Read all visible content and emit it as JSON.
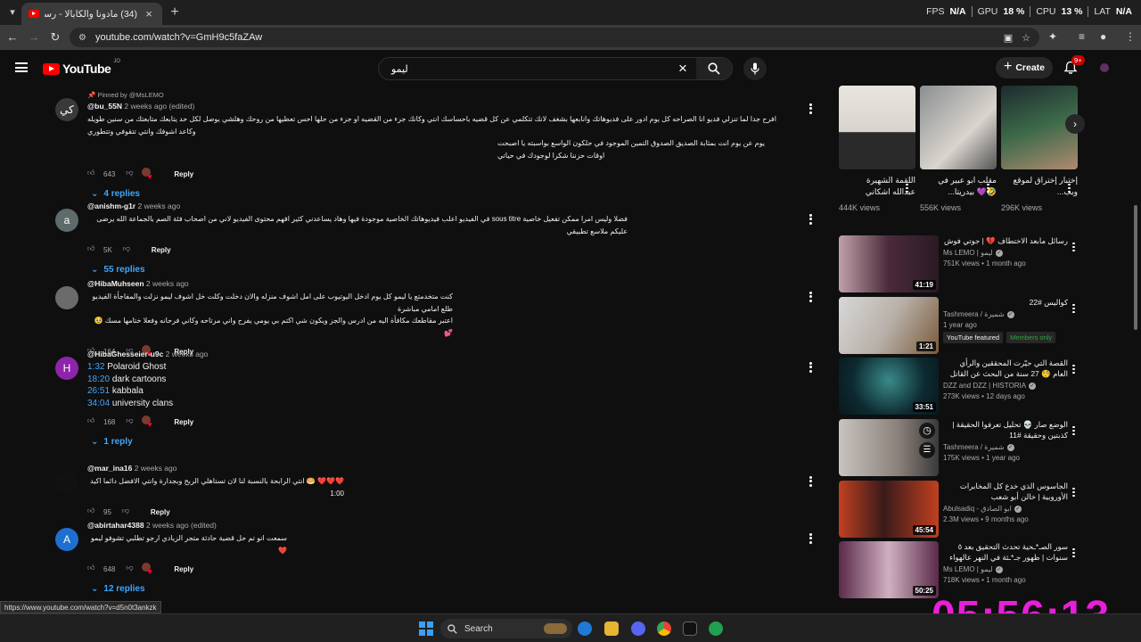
{
  "browser": {
    "tab_title": "(34) مادونا والكابالا - رسائل مبطنة...",
    "new_tab": "+",
    "url": "youtube.com/watch?v=GmH9c5faZAw",
    "stats": {
      "fps_label": "FPS",
      "fps_value": "N/A",
      "gpu_label": "GPU",
      "gpu_value": "18 %",
      "cpu_label": "CPU",
      "cpu_value": "13 %",
      "lat_label": "LAT",
      "lat_value": "N/A"
    }
  },
  "youtube": {
    "logo": "YouTube",
    "logo_country": "JO",
    "search_query": "ليمو",
    "create_label": "Create",
    "notif_badge": "9+"
  },
  "comments": [
    {
      "pinned": "Pinned by @MsLEMO",
      "author": "@bu_55N",
      "time": "2 weeks ago (edited)",
      "avatar": "كي",
      "avatar_color": "#3a3a3a",
      "lines": [
        "افرح جدا لما تنزلي فديو انا الصراحه كل يوم ادور على فديوهاتك وانابعها بشغف لانك تتكلمي عن كل قضيه باحساسك انتي وكانك جزء من القضيه او جزء من حلها احس تعطيها من روحك وهلشي يوصل لكل حد يتابعك متابعتك من سنين طويله وكاعد اشوفك وانتي تتقوفي وتتطوري",
        "يوم عن يوم انت بمثابة الصديق الصدوق التمين الموجود في حلكون الواسع بواسبته يا اصبحت اوقات حزننا شكرا لوجودك في حياتي"
      ],
      "likes": "643",
      "reply_label": "Reply",
      "replies": "4 replies"
    },
    {
      "author": "@anishm-g1r",
      "time": "2 weeks ago",
      "avatar": "a",
      "avatar_color": "#5f6a6a",
      "lines": [
        "فضلا وليس امرا ممكن تفعيل خاصية sous titre في الفيديو اعلب فيديوهاتك الخاصية موجودة فيها وهاد يساعدني كثير افهم محتوى الفيديو لاني من اصحاب فئة الصم بالجماعة الله يرضى عليكم ملاسع تطبيقي"
      ],
      "likes": "5K",
      "reply_label": "Reply",
      "replies": "55 replies"
    },
    {
      "author": "@HibaMuhseen",
      "time": "2 weeks ago",
      "avatar": "",
      "avatar_color": "#6b6b6b",
      "lines": [
        "كنت متخدمتع يا ليمو كل يوم ادخل اليوتيوب على امل اشوف منزله والان دخلت وكلت خل اشوف ليمو نزلت والمفاجأة الفيديو طلع امامي مباشرة",
        "اعتبر مقاطعك مكافأة اليه من ادرس والجز ويكون شي اكتم بي يومي يفرح واني مرتاحه وكاني فرحانه وفعلا ختامها مسك 🥹💕"
      ],
      "likes": "164",
      "reply_label": "Reply"
    },
    {
      "author": "@HibaGhesseier-u9c",
      "time": "2 weeks ago",
      "avatar": "H",
      "avatar_color": "#8e24aa",
      "timestamps": [
        {
          "t": "1:32",
          "label": "Polaroid Ghost"
        },
        {
          "t": "18:20",
          "label": "dark cartoons"
        },
        {
          "t": "26:51",
          "label": "kabbala"
        },
        {
          "t": "34:04",
          "label": "university clans"
        }
      ],
      "likes": "168",
      "reply_label": "Reply",
      "replies": "1 reply"
    },
    {
      "author": "@mar_ina16",
      "time": "2 weeks ago",
      "avatar": "",
      "avatar_color": "#111111",
      "lines": [
        "❤️❤️❤️ 🥯 انتي الرابحة بالنسبة لنا لان تستاهلي الربح وبجدارة وانتي الافضل دائما اكيد 1:00"
      ],
      "likes": "95",
      "reply_label": "Reply"
    },
    {
      "author": "@abirtahar4388",
      "time": "2 weeks ago (edited)",
      "avatar": "A",
      "avatar_color": "#1e6fd0",
      "lines": [
        "سمعت انو تم حل قضية حادثة متجر الزيادي ارجو تطلبي تشوفو ليمو ❤️"
      ],
      "likes": "648",
      "reply_label": "Reply",
      "replies": "12 replies"
    }
  ],
  "shelf": [
    {
      "title": "اللقمة الشهيرة عبدالله اشكاني",
      "views": "444K views",
      "color1": "#e8e4de",
      "color2": "#2a2a2a"
    },
    {
      "title": "مقلب ابو عبير في 🤣💜 بيدريتا...",
      "views": "556K views",
      "color1": "#8a8f90",
      "color2": "#d9d4ce"
    },
    {
      "title": "إختبار إختراق لموقع ويب...",
      "views": "296K views",
      "color1": "#1d2a2f",
      "color2": "#3d6a4a"
    }
  ],
  "videos": [
    {
      "title": "رسائل مابعد الاختطاف 💔 | جوتي فوش",
      "channel": "Ms LEMO | ليمو",
      "views": "751K views",
      "age": "1 month ago",
      "duration": "41:19",
      "c1": "#4a2a3a",
      "c2": "#c0a0a8"
    },
    {
      "title": "كواليس #22",
      "channel": "Tashmeera / شميرة",
      "views": "",
      "age": "1 year ago",
      "duration": "1:21",
      "badge1": "YouTube featured",
      "badge2": "Members only",
      "c1": "#d8d8d8",
      "c2": "#7a5a3a"
    },
    {
      "title": "القصة التي حيّرت المحققين والرأي العام 🧐 27 سنة من البحث عن القاتل",
      "channel": "DZZ and DZZ | HISTORIA",
      "views": "273K views",
      "age": "12 days ago",
      "duration": "33:51",
      "c1": "#0d2a30",
      "c2": "#3a8a8a"
    },
    {
      "title": "الوضع صار 💀 تحليل تعرفوا الحقيقة | كذبتين وحقيقة #11",
      "channel": "Tashmeera / شميرة",
      "views": "175K views",
      "age": "1 year ago",
      "duration": "",
      "c1": "#c8c4bf",
      "c2": "#3a3a3a"
    },
    {
      "title": "الجاسوس الذي خدع كل المخابرات الأوروبية | خالن أبو شعب",
      "channel": "Abulsadiq - ابو الصادق",
      "views": "2.3M views",
      "age": "9 months ago",
      "duration": "45:54",
      "c1": "#3a1a1a",
      "c2": "#c04020"
    },
    {
      "title": "سور الصـ*ـحية تحدث التحقيق بعد ٥ سنوات | ظهور جـ*ـثة في النهر عالهواء 😰",
      "channel": "Ms LEMO | ليمو",
      "views": "718K views",
      "age": "1 month ago",
      "duration": "50:25",
      "c1": "#5a2a4a",
      "c2": "#d0b0c0"
    }
  ],
  "status_url": "https://www.youtube.com/watch?v=d5n0t3ankzk",
  "overlay_clock": "05:56:13",
  "taskbar": {
    "search_label": "Search"
  },
  "colors": {
    "accent": "#3ea6ff",
    "clock": "#e81fd7",
    "brand": "#ff0000"
  }
}
